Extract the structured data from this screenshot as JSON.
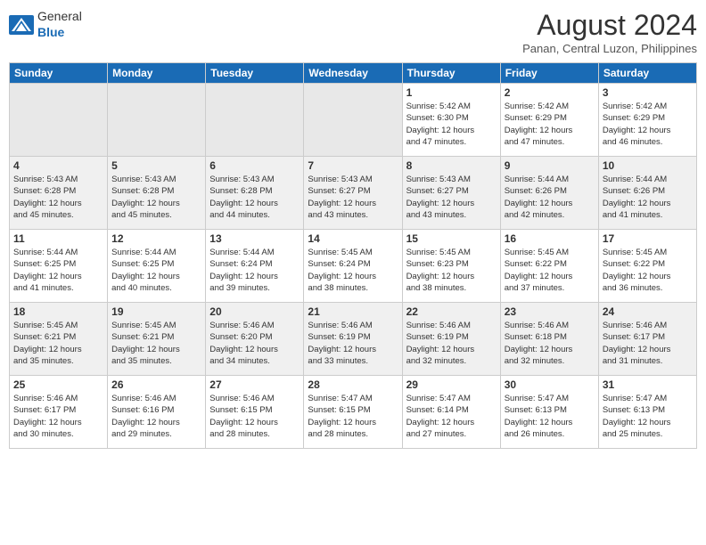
{
  "header": {
    "logo": {
      "general": "General",
      "blue": "Blue"
    },
    "title": "August 2024",
    "location": "Panan, Central Luzon, Philippines"
  },
  "days_of_week": [
    "Sunday",
    "Monday",
    "Tuesday",
    "Wednesday",
    "Thursday",
    "Friday",
    "Saturday"
  ],
  "weeks": [
    {
      "id": "week1",
      "days": [
        {
          "num": "",
          "info": "",
          "empty": true
        },
        {
          "num": "",
          "info": "",
          "empty": true
        },
        {
          "num": "",
          "info": "",
          "empty": true
        },
        {
          "num": "",
          "info": "",
          "empty": true
        },
        {
          "num": "1",
          "info": "Sunrise: 5:42 AM\nSunset: 6:30 PM\nDaylight: 12 hours\nand 47 minutes."
        },
        {
          "num": "2",
          "info": "Sunrise: 5:42 AM\nSunset: 6:29 PM\nDaylight: 12 hours\nand 47 minutes."
        },
        {
          "num": "3",
          "info": "Sunrise: 5:42 AM\nSunset: 6:29 PM\nDaylight: 12 hours\nand 46 minutes."
        }
      ]
    },
    {
      "id": "week2",
      "days": [
        {
          "num": "4",
          "info": "Sunrise: 5:43 AM\nSunset: 6:28 PM\nDaylight: 12 hours\nand 45 minutes."
        },
        {
          "num": "5",
          "info": "Sunrise: 5:43 AM\nSunset: 6:28 PM\nDaylight: 12 hours\nand 45 minutes."
        },
        {
          "num": "6",
          "info": "Sunrise: 5:43 AM\nSunset: 6:28 PM\nDaylight: 12 hours\nand 44 minutes."
        },
        {
          "num": "7",
          "info": "Sunrise: 5:43 AM\nSunset: 6:27 PM\nDaylight: 12 hours\nand 43 minutes."
        },
        {
          "num": "8",
          "info": "Sunrise: 5:43 AM\nSunset: 6:27 PM\nDaylight: 12 hours\nand 43 minutes."
        },
        {
          "num": "9",
          "info": "Sunrise: 5:44 AM\nSunset: 6:26 PM\nDaylight: 12 hours\nand 42 minutes."
        },
        {
          "num": "10",
          "info": "Sunrise: 5:44 AM\nSunset: 6:26 PM\nDaylight: 12 hours\nand 41 minutes."
        }
      ]
    },
    {
      "id": "week3",
      "days": [
        {
          "num": "11",
          "info": "Sunrise: 5:44 AM\nSunset: 6:25 PM\nDaylight: 12 hours\nand 41 minutes."
        },
        {
          "num": "12",
          "info": "Sunrise: 5:44 AM\nSunset: 6:25 PM\nDaylight: 12 hours\nand 40 minutes."
        },
        {
          "num": "13",
          "info": "Sunrise: 5:44 AM\nSunset: 6:24 PM\nDaylight: 12 hours\nand 39 minutes."
        },
        {
          "num": "14",
          "info": "Sunrise: 5:45 AM\nSunset: 6:24 PM\nDaylight: 12 hours\nand 38 minutes."
        },
        {
          "num": "15",
          "info": "Sunrise: 5:45 AM\nSunset: 6:23 PM\nDaylight: 12 hours\nand 38 minutes."
        },
        {
          "num": "16",
          "info": "Sunrise: 5:45 AM\nSunset: 6:22 PM\nDaylight: 12 hours\nand 37 minutes."
        },
        {
          "num": "17",
          "info": "Sunrise: 5:45 AM\nSunset: 6:22 PM\nDaylight: 12 hours\nand 36 minutes."
        }
      ]
    },
    {
      "id": "week4",
      "days": [
        {
          "num": "18",
          "info": "Sunrise: 5:45 AM\nSunset: 6:21 PM\nDaylight: 12 hours\nand 35 minutes."
        },
        {
          "num": "19",
          "info": "Sunrise: 5:45 AM\nSunset: 6:21 PM\nDaylight: 12 hours\nand 35 minutes."
        },
        {
          "num": "20",
          "info": "Sunrise: 5:46 AM\nSunset: 6:20 PM\nDaylight: 12 hours\nand 34 minutes."
        },
        {
          "num": "21",
          "info": "Sunrise: 5:46 AM\nSunset: 6:19 PM\nDaylight: 12 hours\nand 33 minutes."
        },
        {
          "num": "22",
          "info": "Sunrise: 5:46 AM\nSunset: 6:19 PM\nDaylight: 12 hours\nand 32 minutes."
        },
        {
          "num": "23",
          "info": "Sunrise: 5:46 AM\nSunset: 6:18 PM\nDaylight: 12 hours\nand 32 minutes."
        },
        {
          "num": "24",
          "info": "Sunrise: 5:46 AM\nSunset: 6:17 PM\nDaylight: 12 hours\nand 31 minutes."
        }
      ]
    },
    {
      "id": "week5",
      "days": [
        {
          "num": "25",
          "info": "Sunrise: 5:46 AM\nSunset: 6:17 PM\nDaylight: 12 hours\nand 30 minutes."
        },
        {
          "num": "26",
          "info": "Sunrise: 5:46 AM\nSunset: 6:16 PM\nDaylight: 12 hours\nand 29 minutes."
        },
        {
          "num": "27",
          "info": "Sunrise: 5:46 AM\nSunset: 6:15 PM\nDaylight: 12 hours\nand 28 minutes."
        },
        {
          "num": "28",
          "info": "Sunrise: 5:47 AM\nSunset: 6:15 PM\nDaylight: 12 hours\nand 28 minutes."
        },
        {
          "num": "29",
          "info": "Sunrise: 5:47 AM\nSunset: 6:14 PM\nDaylight: 12 hours\nand 27 minutes."
        },
        {
          "num": "30",
          "info": "Sunrise: 5:47 AM\nSunset: 6:13 PM\nDaylight: 12 hours\nand 26 minutes."
        },
        {
          "num": "31",
          "info": "Sunrise: 5:47 AM\nSunset: 6:13 PM\nDaylight: 12 hours\nand 25 minutes."
        }
      ]
    }
  ]
}
